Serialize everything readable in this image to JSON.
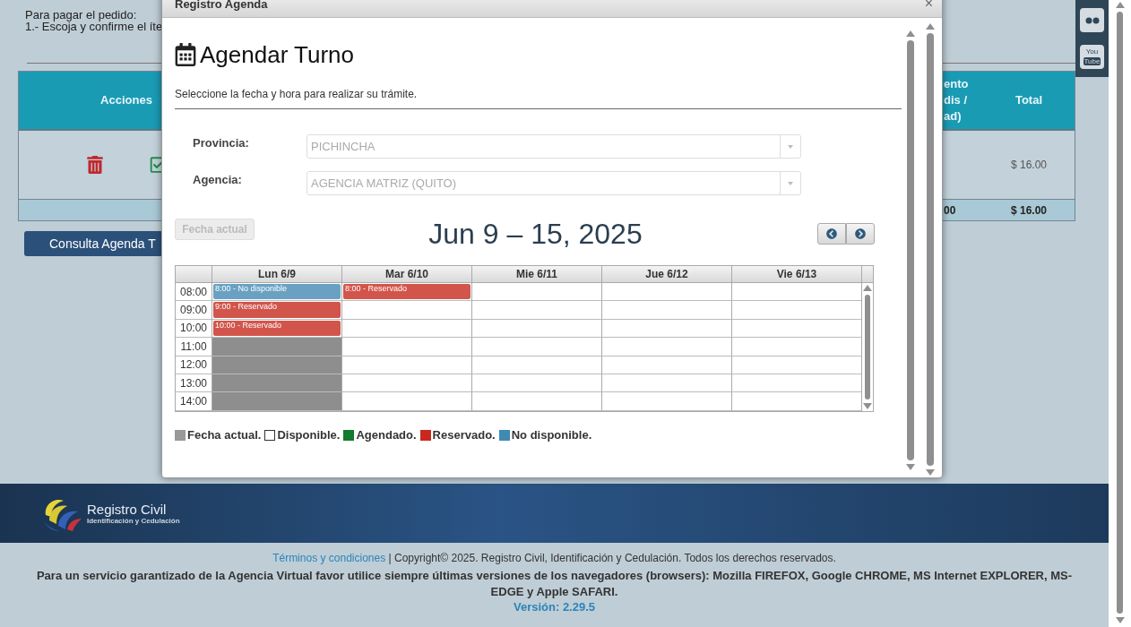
{
  "page": {
    "intro": [
      "Para pagar el pedido:",
      "1.- Escoja y confirme el íte"
    ],
    "table": {
      "actions_header": "Acciones",
      "partial_header": [
        "ento",
        "dis /",
        "ad)"
      ],
      "total_header": "Total",
      "row_total": "$ 16.00",
      "footer_partial": "00",
      "footer_total": "$ 16.00"
    },
    "consult_button": "Consulta Agenda T"
  },
  "social": [
    {
      "kind": "flickr"
    },
    {
      "kind": "youtube",
      "top": "You",
      "bottom": "Tube"
    }
  ],
  "modal": {
    "title": "Registro Agenda",
    "close": "×",
    "heading": "Agendar Turno",
    "subtitle": "Seleccione la fecha y hora para realizar su trámite.",
    "fields": [
      {
        "label": "Provincia:",
        "value": "PICHINCHA",
        "disabled": true
      },
      {
        "label": "Agencia:",
        "value": "AGENCIA MATRIZ (QUITO)",
        "disabled": true
      }
    ],
    "today_button": {
      "label": "Fecha actual",
      "disabled": true
    },
    "range": "Jun 9 – 15, 2025",
    "times": [
      "08:00",
      "09:00",
      "10:00",
      "11:00",
      "12:00",
      "13:00",
      "14:00"
    ],
    "days": [
      {
        "label": "Lun 6/9",
        "slots": [
          {
            "kind": "no_disponible",
            "text": "8:00 - No disponible"
          },
          {
            "kind": "reservado",
            "text": "9:00 - Reservado"
          },
          {
            "kind": "reservado",
            "text": "10:00 - Reservado"
          },
          {
            "kind": "fecha_actual"
          },
          {
            "kind": "fecha_actual"
          },
          {
            "kind": "fecha_actual"
          },
          {
            "kind": "fecha_actual"
          }
        ]
      },
      {
        "label": "Mar 6/10",
        "slots": [
          {
            "kind": "reservado",
            "text": "8:00 - Reservado"
          }
        ]
      },
      {
        "label": "Mie 6/11"
      },
      {
        "label": "Jue 6/12"
      },
      {
        "label": "Vie 6/13"
      }
    ],
    "legend": [
      {
        "label": "Fecha actual.",
        "color": "#999999"
      },
      {
        "label": "Disponible.",
        "color": "#ffffff"
      },
      {
        "label": "Agendado.",
        "color": "#137a2e"
      },
      {
        "label": "Reservado.",
        "color": "#c8281e"
      },
      {
        "label": "No disponible.",
        "color": "#3f8ab4"
      }
    ]
  },
  "footer": {
    "logo_name": "Registro Civil",
    "logo_tagline": "Identificación y Cedulación",
    "terms_link": "Términos y condiciones",
    "copyright": " | Copyright© 2025. Registro Civil, Identificación y Cedulación. Todos los derechos reservados.",
    "notice": "Para un servicio garantizado de la Agencia Virtual favor utilice siempre últimas versiones de los navegadores (browsers): Mozilla FIREFOX, Google CHROME, MS Internet EXPLORER, MS-EDGE y Apple SAFARI.",
    "version": "Versión: 2.29.5"
  }
}
